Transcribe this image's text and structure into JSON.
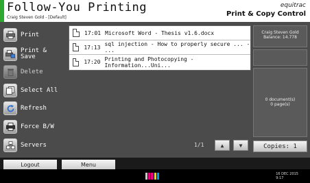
{
  "header": {
    "title": "Follow-You Printing",
    "user": "Craig Steven Gold - [Default]",
    "logo": "equitrac",
    "subtitle": "Print & Copy Control",
    "accent_color": "#2ea82e"
  },
  "sidebar": {
    "print": {
      "label": "Print",
      "icon": "printer-icon"
    },
    "print_save": {
      "label": "Print &\nSave",
      "icon": "print-save-icon"
    },
    "delete": {
      "label": "Delete",
      "icon": "trash-icon"
    },
    "select_all": {
      "label": "Select All",
      "icon": "select-all-icon"
    },
    "refresh": {
      "label": "Refresh",
      "icon": "refresh-icon"
    },
    "force_bw": {
      "label": "Force B/W",
      "icon": "force-bw-icon"
    },
    "servers": {
      "label": "Servers",
      "icon": "servers-icon"
    }
  },
  "jobs": [
    {
      "time": "17:01",
      "name": "Microsoft Word - Thesis v1.6.docx"
    },
    {
      "time": "17:13",
      "name": "sql injection - How to properly secure ... - ..."
    },
    {
      "time": "17:20",
      "name": "Printing and Photocopying - Information...Uni..."
    }
  ],
  "user_panel": {
    "name": "Craig Steven Gold",
    "balance": "Balance: 14.778"
  },
  "summary": {
    "documents": "0 document(s)",
    "pages": "0 page(s)"
  },
  "pager": {
    "page": "1/1",
    "up": "▲",
    "down": "▼"
  },
  "copies_label": "Copies: 1",
  "tabs": {
    "logout": "Logout",
    "menu": "Menu"
  },
  "status": {
    "date": "16 DEC  2015",
    "time": "9:17",
    "ink_colors": [
      "#c8c8c8",
      "#e6007e",
      "#e6007e",
      "#ffd400",
      "#00a0e9"
    ]
  }
}
